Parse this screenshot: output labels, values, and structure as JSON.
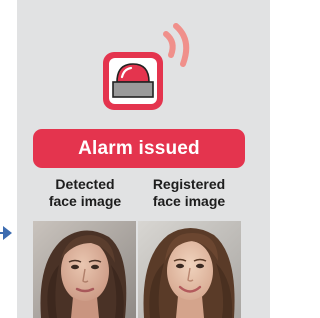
{
  "alarm": {
    "badge_label": "Alarm issued",
    "accent_color": "#e4344e",
    "icon": "alarm-beacon-icon"
  },
  "captions": {
    "detected": [
      "Detected",
      "face image"
    ],
    "registered": [
      "Registered",
      "face image"
    ]
  },
  "images": {
    "detected": "detected-face-photo",
    "registered": "registered-face-photo"
  },
  "flow": {
    "arrow_icon": "right-arrow-icon",
    "arrow_color": "#3d6cb0"
  }
}
